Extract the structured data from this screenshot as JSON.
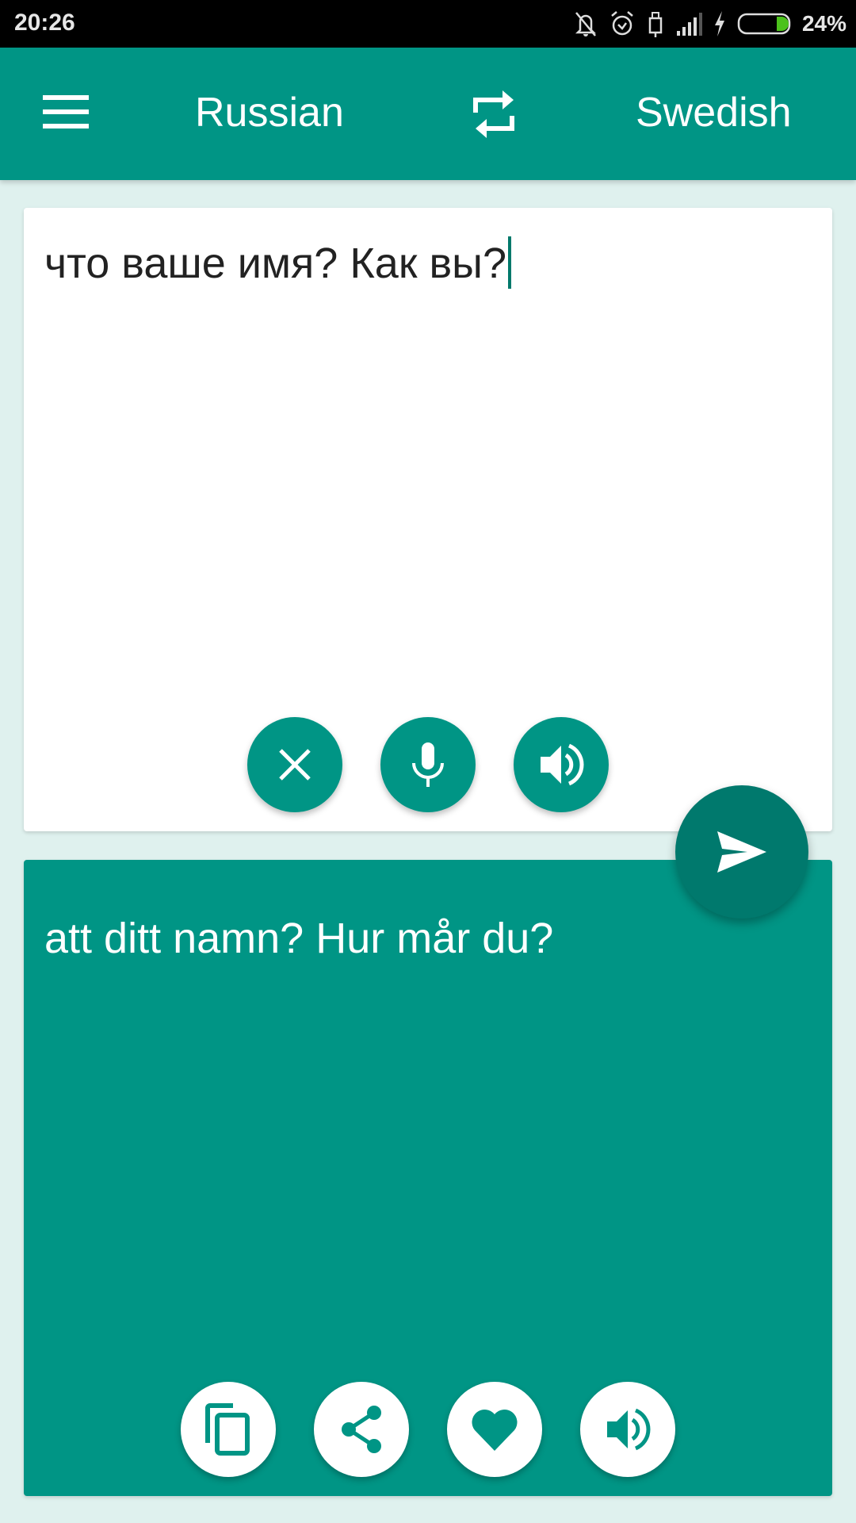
{
  "status_bar": {
    "time": "20:26",
    "battery_percent": "24%",
    "battery_level": 0.24,
    "icons": [
      "notifications-off-icon",
      "alarm-icon",
      "usb-icon",
      "signal-icon",
      "charging-icon",
      "battery-icon"
    ]
  },
  "app_bar": {
    "menu_icon": "hamburger-menu-icon",
    "source_language": "Russian",
    "swap_icon": "swap-languages-icon",
    "target_language": "Swedish"
  },
  "input_card": {
    "text": "что ваше имя? Как вы?",
    "actions": [
      {
        "name": "clear",
        "icon": "close-icon"
      },
      {
        "name": "voice-input",
        "icon": "microphone-icon"
      },
      {
        "name": "speak-input",
        "icon": "speaker-icon"
      }
    ]
  },
  "translate_button": {
    "icon": "send-icon"
  },
  "output_card": {
    "text": "att ditt namn? Hur mår du?",
    "actions": [
      {
        "name": "copy",
        "icon": "copy-icon"
      },
      {
        "name": "share",
        "icon": "share-icon"
      },
      {
        "name": "favorite",
        "icon": "heart-icon"
      },
      {
        "name": "speak-output",
        "icon": "speaker-icon"
      }
    ]
  },
  "colors": {
    "primary": "#009585",
    "primary_dark": "#00796d",
    "background": "#dff1ee",
    "status_bar": "#000000",
    "battery_green": "#4cc21c"
  }
}
